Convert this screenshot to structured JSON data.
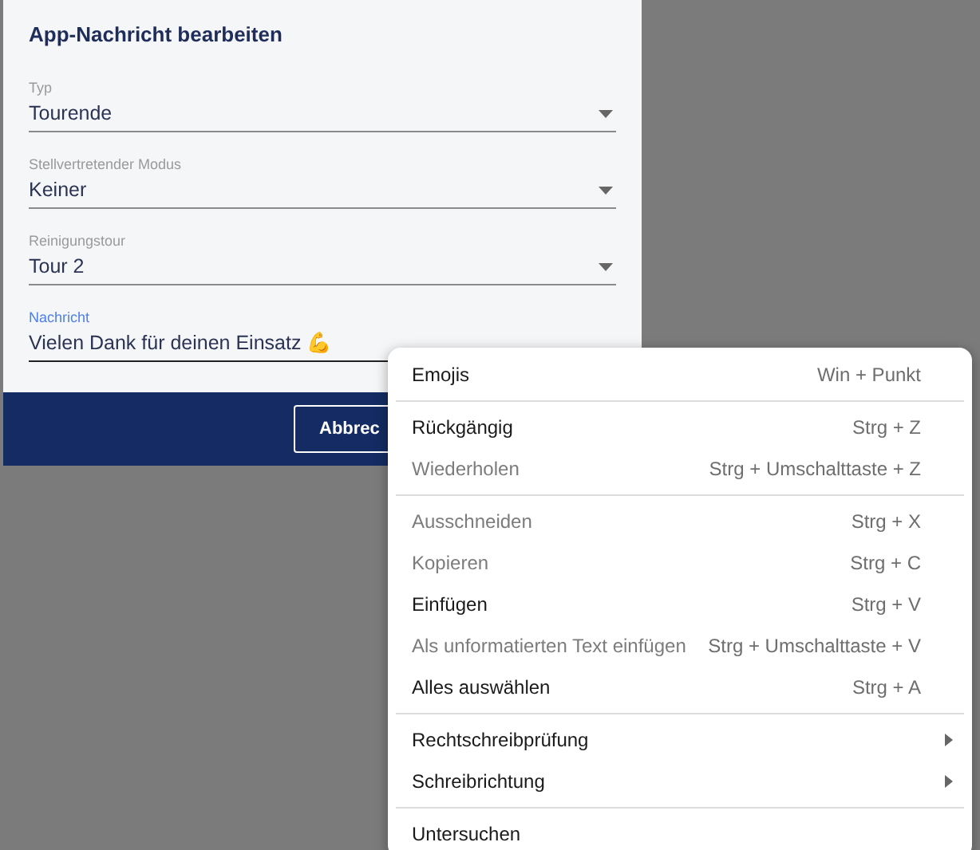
{
  "dialog": {
    "title": "App-Nachricht bearbeiten",
    "fields": [
      {
        "kind": "select",
        "label": "Typ",
        "value": "Tourende",
        "focused": false
      },
      {
        "kind": "select",
        "label": "Stellvertretender Modus",
        "value": "Keiner",
        "focused": false
      },
      {
        "kind": "select",
        "label": "Reinigungstour",
        "value": "Tour 2",
        "focused": false
      },
      {
        "kind": "text",
        "label": "Nachricht",
        "value": "Vielen Dank für deinen Einsatz 💪",
        "focused": true
      }
    ],
    "buttons": [
      "Abbrec"
    ]
  },
  "context_menu": [
    {
      "kind": "item",
      "label": "Emojis",
      "shortcut": "Win + Punkt",
      "disabled": false
    },
    {
      "kind": "separator"
    },
    {
      "kind": "item",
      "label": "Rückgängig",
      "shortcut": "Strg + Z",
      "disabled": false
    },
    {
      "kind": "item",
      "label": "Wiederholen",
      "shortcut": "Strg + Umschalttaste + Z",
      "disabled": true
    },
    {
      "kind": "separator"
    },
    {
      "kind": "item",
      "label": "Ausschneiden",
      "shortcut": "Strg + X",
      "disabled": true
    },
    {
      "kind": "item",
      "label": "Kopieren",
      "shortcut": "Strg + C",
      "disabled": true
    },
    {
      "kind": "item",
      "label": "Einfügen",
      "shortcut": "Strg + V",
      "disabled": false
    },
    {
      "kind": "item",
      "label": "Als unformatierten Text einfügen",
      "shortcut": "Strg + Umschalttaste + V",
      "disabled": true
    },
    {
      "kind": "item",
      "label": "Alles auswählen",
      "shortcut": "Strg + A",
      "disabled": false
    },
    {
      "kind": "separator"
    },
    {
      "kind": "submenu",
      "label": "Rechtschreibprüfung",
      "disabled": false
    },
    {
      "kind": "submenu",
      "label": "Schreibrichtung",
      "disabled": false
    },
    {
      "kind": "separator"
    },
    {
      "kind": "item",
      "label": "Untersuchen",
      "disabled": false
    }
  ]
}
